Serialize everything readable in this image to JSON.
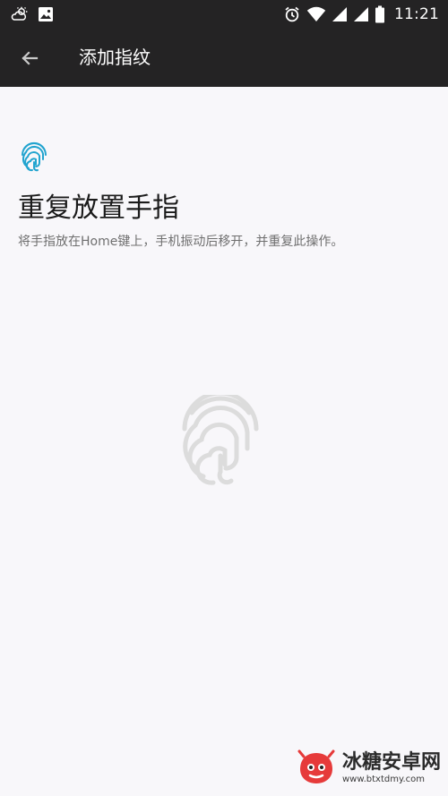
{
  "status_bar": {
    "time": "11:21",
    "left_icons": [
      "cloud-weather-icon",
      "image-icon"
    ],
    "right_icons": [
      "alarm-icon",
      "wifi-icon",
      "signal-icon",
      "signal-icon",
      "battery-icon"
    ]
  },
  "app_bar": {
    "title": "添加指纹",
    "back_icon": "arrow-left-icon"
  },
  "main": {
    "small_icon": "fingerprint-icon",
    "headline": "重复放置手指",
    "subtitle": "将手指放在Home键上，手机振动后移开，并重复此操作。",
    "large_icon": "fingerprint-icon"
  },
  "watermark": {
    "title": "冰糖安卓网",
    "url": "www.btxtdmy.com"
  },
  "colors": {
    "bar_bg": "#242324",
    "content_bg": "#f8f7fa",
    "accent": "#22a4cf",
    "text_primary": "#1b1b1b",
    "text_secondary": "#6f6f6f",
    "fingerprint_faint": "#dcdcdc"
  }
}
